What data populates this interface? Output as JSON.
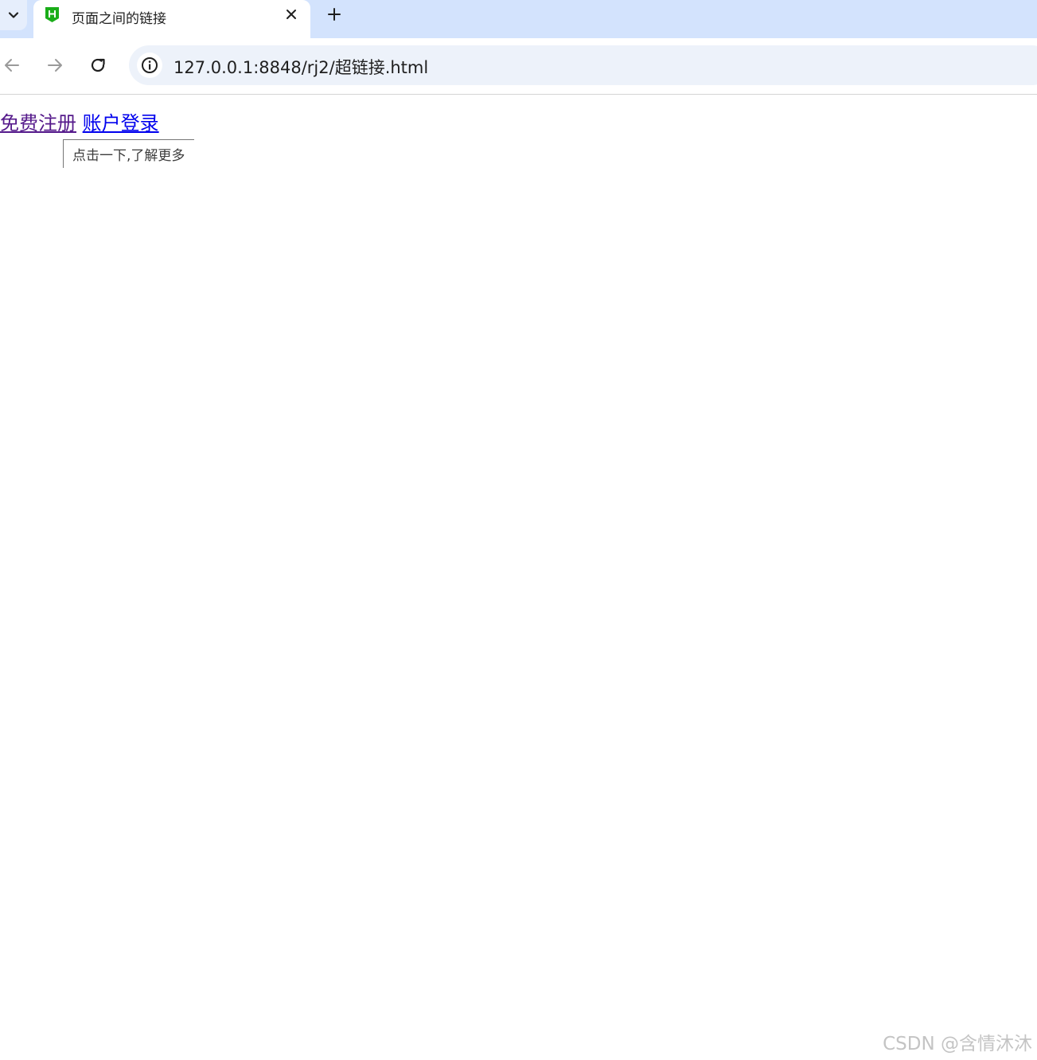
{
  "browser": {
    "tab": {
      "title": "页面之间的链接",
      "favicon": "hbuilder-h-icon",
      "favicon_color": "#1aad19"
    },
    "address_bar": {
      "url": "127.0.0.1:8848/rj2/超链接.html"
    },
    "colors": {
      "tabstrip": "#d3e3fd",
      "omnibox": "#edf2fa"
    }
  },
  "page": {
    "links": [
      {
        "label": "免费注册",
        "state": "visited",
        "color": "#551a8b"
      },
      {
        "label": "账户登录",
        "state": "unvisited",
        "color": "#0000ee"
      }
    ],
    "tooltip": "点击一下,了解更多"
  },
  "watermark": "CSDN @含情沐沐"
}
